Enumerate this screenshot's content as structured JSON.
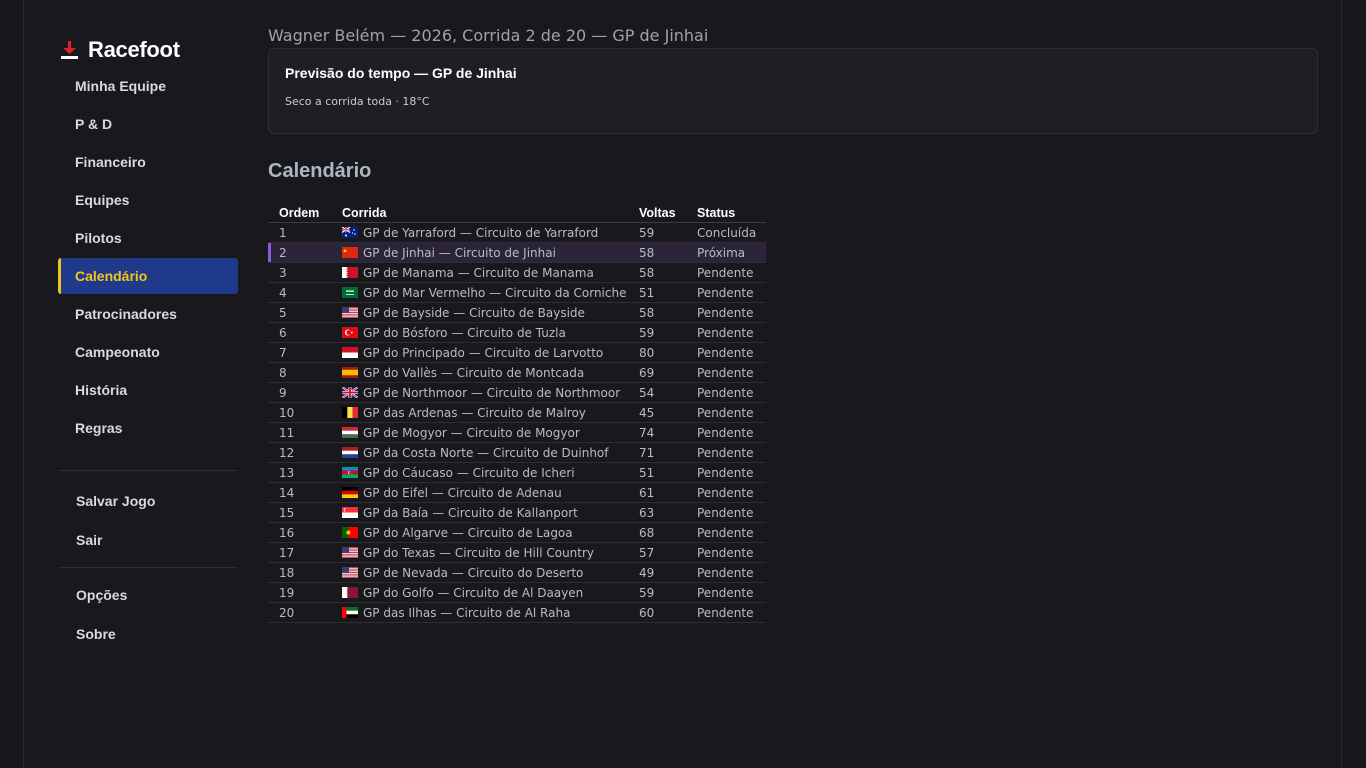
{
  "app": {
    "name": "Racefoot"
  },
  "sidebar": {
    "items": [
      {
        "label": "Minha Equipe",
        "active": false
      },
      {
        "label": "P & D",
        "active": false
      },
      {
        "label": "Financeiro",
        "active": false
      },
      {
        "label": "Equipes",
        "active": false
      },
      {
        "label": "Pilotos",
        "active": false
      },
      {
        "label": "Calendário",
        "active": true
      },
      {
        "label": "Patrocinadores",
        "active": false
      },
      {
        "label": "Campeonato",
        "active": false
      },
      {
        "label": "História",
        "active": false
      },
      {
        "label": "Regras",
        "active": false
      }
    ],
    "actions": [
      {
        "label": "Salvar Jogo"
      },
      {
        "label": "Sair"
      }
    ],
    "extras": [
      {
        "label": "Opções"
      },
      {
        "label": "Sobre"
      }
    ]
  },
  "header": {
    "line": "Wagner Belém — 2026, Corrida 2 de 20 — GP de Jinhai"
  },
  "weather": {
    "title": "Previsão do tempo — GP de Jinhai",
    "desc": "Seco a corrida toda · 18°C"
  },
  "calendar": {
    "title": "Calendário",
    "columns": {
      "order": "Ordem",
      "race": "Corrida",
      "laps": "Voltas",
      "status": "Status"
    },
    "rows": [
      {
        "order": "1",
        "flag": "au",
        "race": "GP de Yarraford — Circuito de Yarraford",
        "laps": "59",
        "status": "Concluída"
      },
      {
        "order": "2",
        "flag": "cn",
        "race": "GP de Jinhai — Circuito de Jinhai",
        "laps": "58",
        "status": "Próxima",
        "current": true
      },
      {
        "order": "3",
        "flag": "bh",
        "race": "GP de Manama — Circuito de Manama",
        "laps": "58",
        "status": "Pendente"
      },
      {
        "order": "4",
        "flag": "sa",
        "race": "GP do Mar Vermelho — Circuito da Corniche",
        "laps": "51",
        "status": "Pendente"
      },
      {
        "order": "5",
        "flag": "us",
        "race": "GP de Bayside — Circuito de Bayside",
        "laps": "58",
        "status": "Pendente"
      },
      {
        "order": "6",
        "flag": "tr",
        "race": "GP do Bósforo — Circuito de Tuzla",
        "laps": "59",
        "status": "Pendente"
      },
      {
        "order": "7",
        "flag": "mc",
        "race": "GP do Principado — Circuito de Larvotto",
        "laps": "80",
        "status": "Pendente"
      },
      {
        "order": "8",
        "flag": "es",
        "race": "GP do Vallès — Circuito de Montcada",
        "laps": "69",
        "status": "Pendente"
      },
      {
        "order": "9",
        "flag": "gb",
        "race": "GP de Northmoor — Circuito de Northmoor",
        "laps": "54",
        "status": "Pendente"
      },
      {
        "order": "10",
        "flag": "be",
        "race": "GP das Ardenas — Circuito de Malroy",
        "laps": "45",
        "status": "Pendente"
      },
      {
        "order": "11",
        "flag": "hu",
        "race": "GP de Mogyor — Circuito de Mogyor",
        "laps": "74",
        "status": "Pendente"
      },
      {
        "order": "12",
        "flag": "nl",
        "race": "GP da Costa Norte — Circuito de Duinhof",
        "laps": "71",
        "status": "Pendente"
      },
      {
        "order": "13",
        "flag": "az",
        "race": "GP do Cáucaso — Circuito de Icheri",
        "laps": "51",
        "status": "Pendente"
      },
      {
        "order": "14",
        "flag": "de",
        "race": "GP do Eifel — Circuito de Adenau",
        "laps": "61",
        "status": "Pendente"
      },
      {
        "order": "15",
        "flag": "sg",
        "race": "GP da Baía — Circuito de Kallanport",
        "laps": "63",
        "status": "Pendente"
      },
      {
        "order": "16",
        "flag": "pt",
        "race": "GP do Algarve — Circuito de Lagoa",
        "laps": "68",
        "status": "Pendente"
      },
      {
        "order": "17",
        "flag": "us",
        "race": "GP do Texas — Circuito de Hill Country",
        "laps": "57",
        "status": "Pendente"
      },
      {
        "order": "18",
        "flag": "us",
        "race": "GP de Nevada — Circuito do Deserto",
        "laps": "49",
        "status": "Pendente"
      },
      {
        "order": "19",
        "flag": "qa",
        "race": "GP do Golfo — Circuito de Al Daayen",
        "laps": "59",
        "status": "Pendente"
      },
      {
        "order": "20",
        "flag": "ae",
        "race": "GP das Ilhas — Circuito de Al Raha",
        "laps": "60",
        "status": "Pendente"
      }
    ]
  }
}
